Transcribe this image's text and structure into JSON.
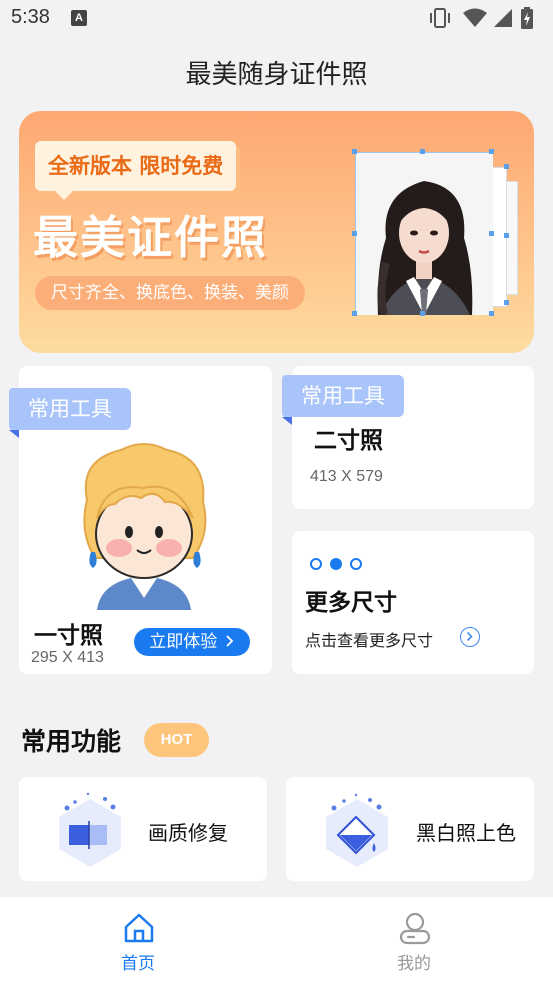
{
  "status": {
    "time": "5:38",
    "badge": "A"
  },
  "header": {
    "title": "最美随身证件照"
  },
  "banner": {
    "tag": "全新版本 限时免费",
    "headline": "最美证件照",
    "subtitle": "尺寸齐全、换底色、换装、美颜"
  },
  "tools": {
    "one_inch": {
      "tag": "常用工具",
      "name": "一寸照",
      "size": "295 X 413",
      "button": "立即体验"
    },
    "two_inch": {
      "tag": "常用工具",
      "name": "二寸照",
      "size": "413 X 579"
    },
    "more": {
      "title": "更多尺寸",
      "desc": "点击查看更多尺寸"
    }
  },
  "features": {
    "title": "常用功能",
    "badge": "HOT",
    "items": [
      {
        "label": "画质修复",
        "icon": "photo-repair-icon"
      },
      {
        "label": "黑白照上色",
        "icon": "colorize-icon"
      }
    ]
  },
  "tabbar": {
    "items": [
      {
        "label": "首页",
        "icon": "home-icon",
        "active": true
      },
      {
        "label": "我的",
        "icon": "profile-icon",
        "active": false
      }
    ]
  },
  "colors": {
    "accent": "#1a7bf0",
    "banner_top": "#fea872",
    "banner_bottom": "#fddc9f",
    "tag_blue": "#a8c4fb",
    "hot": "#fdc57c",
    "inactive": "#9a9a9a"
  }
}
